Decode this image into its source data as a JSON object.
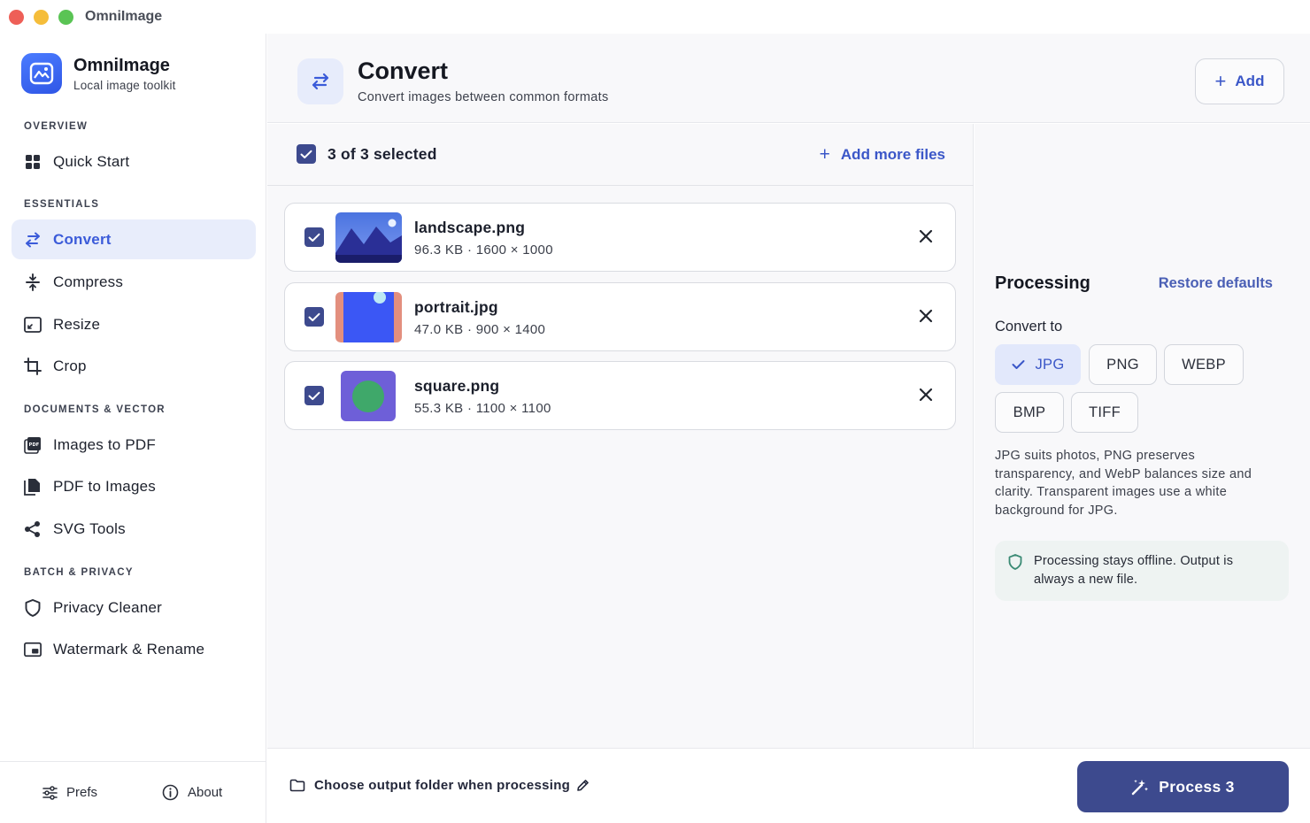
{
  "window": {
    "title": "OmniImage"
  },
  "brand": {
    "name": "OmniImage",
    "subtitle": "Local image toolkit"
  },
  "sidebar": {
    "sections": [
      "OVERVIEW",
      "ESSENTIALS",
      "DOCUMENTS & VECTOR",
      "BATCH & PRIVACY"
    ],
    "items": [
      {
        "label": "Quick Start",
        "icon": "grid-icon"
      },
      {
        "label": "Convert",
        "icon": "swap-arrows-icon",
        "active": true
      },
      {
        "label": "Compress",
        "icon": "compress-icon"
      },
      {
        "label": "Resize",
        "icon": "resize-icon"
      },
      {
        "label": "Crop",
        "icon": "crop-icon"
      },
      {
        "label": "Images to PDF",
        "icon": "pdf-icon"
      },
      {
        "label": "PDF to Images",
        "icon": "file-copy-icon"
      },
      {
        "label": "SVG Tools",
        "icon": "share-nodes-icon"
      },
      {
        "label": "Privacy Cleaner",
        "icon": "shield-icon"
      },
      {
        "label": "Watermark & Rename",
        "icon": "picture-in-picture-icon"
      }
    ],
    "footer": {
      "prefs": "Prefs",
      "about": "About"
    }
  },
  "header": {
    "title": "Convert",
    "subtitle": "Convert images between common formats",
    "add_label": "Add"
  },
  "files": {
    "selection_text": "3 of 3 selected",
    "add_more_label": "Add more files",
    "items": [
      {
        "name": "landscape.png",
        "meta": "96.3 KB · 1600 × 1000",
        "checked": true
      },
      {
        "name": "portrait.jpg",
        "meta": "47.0 KB · 900 × 1400",
        "checked": true
      },
      {
        "name": "square.png",
        "meta": "55.3 KB · 1100 × 1100",
        "checked": true
      }
    ]
  },
  "processing": {
    "title": "Processing",
    "restore_label": "Restore defaults",
    "convert_to_label": "Convert to",
    "formats": [
      "JPG",
      "PNG",
      "WEBP",
      "BMP",
      "TIFF"
    ],
    "selected_format": "JPG",
    "description": "JPG suits photos, PNG preserves transparency, and WebP balances size and clarity. Transparent images use a white background for JPG.",
    "offline_note": "Processing stays offline. Output is always a new file."
  },
  "bottom": {
    "output_folder_label": "Choose output folder when processing",
    "process_label": "Process 3"
  },
  "colors": {
    "accent": "#3b57c8",
    "primary_button": "#3d4a8e",
    "active_nav_bg": "#e8edfb"
  }
}
